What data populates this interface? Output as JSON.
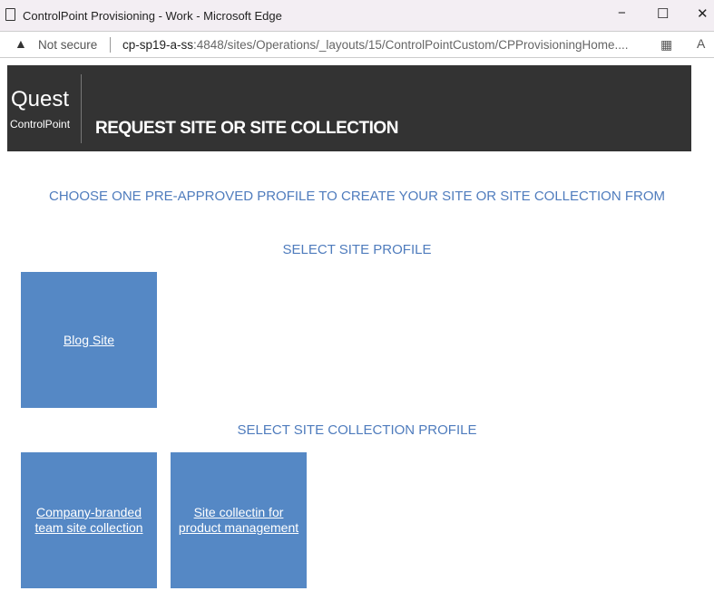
{
  "window": {
    "title": "ControlPoint Provisioning - Work - Microsoft Edge",
    "minimize": "−",
    "maximize": "☐",
    "close": "✕"
  },
  "addressbar": {
    "security": "Not secure",
    "url_host": "cp-sp19-a-ss",
    "url_rest": ":4848/sites/Operations/_layouts/15/ControlPointCustom/CPProvisioningHome...."
  },
  "banner": {
    "logo_top": "Quest",
    "logo_bottom": "ControlPoint",
    "title": "REQUEST SITE OR SITE COLLECTION"
  },
  "main": {
    "instruction": "CHOOSE ONE PRE-APPROVED PROFILE TO CREATE YOUR SITE OR SITE COLLECTION FROM",
    "site_heading": "SELECT SITE PROFILE",
    "site_profiles": [
      "Blog Site"
    ],
    "collection_heading": "SELECT SITE COLLECTION PROFILE",
    "collection_profiles": [
      "Company-branded team site collection",
      "Site collectin for product management"
    ]
  }
}
